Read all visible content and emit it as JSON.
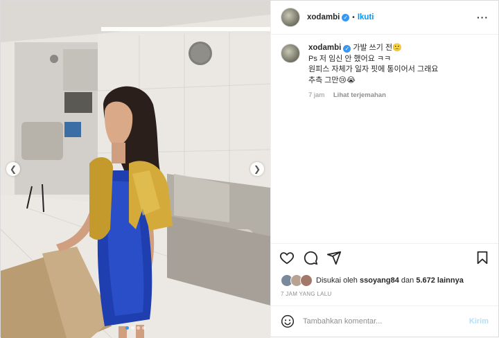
{
  "post": {
    "username": "xodambi",
    "follow_label": "Ikuti",
    "separator": "•",
    "caption_lines": [
      "가발 쓰기 전🙁",
      "Ps 저 임신 안 했어요 ㅋㅋ",
      "원피스 자체가 일자 핏에 통이어서 그래요",
      "추측 그만😢😭"
    ],
    "caption_time": "7 jam",
    "translate_label": "Lihat terjemahan",
    "likes_prefix": "Disukai oleh",
    "likes_user": "ssoyang84",
    "likes_and": "dan",
    "likes_count": "5.672 lainnya",
    "posted_ago": "7 JAM YANG LALU",
    "comment_placeholder": "Tambahkan komentar...",
    "post_label": "Kirim",
    "carousel_total": 4,
    "carousel_active": 1
  },
  "colors": {
    "accent": "#0095f6",
    "verified": "#3897f0",
    "muted": "#8e8e8e",
    "post_disabled": "#b2dffc"
  },
  "icons": [
    "verified-badge-icon",
    "more-options-icon",
    "prev-arrow-icon",
    "next-arrow-icon",
    "heart-icon",
    "comment-icon",
    "share-icon",
    "bookmark-icon",
    "emoji-icon"
  ]
}
